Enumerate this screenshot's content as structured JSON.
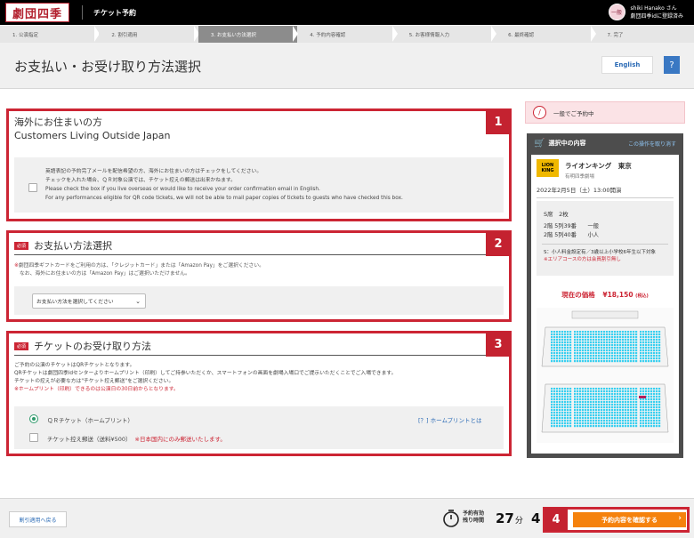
{
  "header": {
    "logo_text": "劇団四季",
    "app_title": "チケット予約",
    "avatar_text": "一般",
    "user_name": "shiki Hanako さん",
    "user_status": "劇団四季idに登録済み"
  },
  "steps": [
    {
      "label": "1. 公演指定",
      "state": "done"
    },
    {
      "label": "2. 割引適用",
      "state": "done"
    },
    {
      "label": "3. お支払い方法選択",
      "state": "active"
    },
    {
      "label": "4. 予約内容確認",
      "state": "todo"
    },
    {
      "label": "5. お客様情報入力",
      "state": "todo"
    },
    {
      "label": "6. 最終確認",
      "state": "todo"
    },
    {
      "label": "7. 完了",
      "state": "todo"
    }
  ],
  "title": {
    "text": "お支払い・お受け取り方法選択",
    "english_label": "English",
    "help_label": "?"
  },
  "section1": {
    "badge": "1",
    "heading_ja": "海外にお住まいの方",
    "heading_en": "Customers Living Outside Japan",
    "lines": [
      "英語表記の予約完了メールを配信希望の方、海外にお住まいの方はチェックをしてください。",
      "チェックを入れた場合、ＱＲ対象公演では、チケット控えの郵送は出来かねます。",
      "Please check the box if you live overseas or would like to receive your order confirmation email in English.",
      "For any performances eligible for QR code tickets, we will not be able to mail paper copies of tickets to guests who have checked this box."
    ]
  },
  "section2": {
    "badge": "2",
    "required": "必須",
    "heading": "お支払い方法選択",
    "note_mark": "※",
    "note_line1": "劇団四季ギフトカードをご利用の方は、「クレジットカード」または「Amazon Pay」をご選択ください。",
    "note_line2": "なお、海外にお住まいの方は「Amazon Pay」はご選択いただけません。",
    "select_value": "お支払い方法を選択してください"
  },
  "section3": {
    "badge": "3",
    "required": "必須",
    "heading": "チケットのお受け取り方法",
    "lines": [
      "ご予約の公演のチケットはQRチケットとなります。",
      "QRチケットは劇団四季idセンターよりホームプリント（印刷）してご持参いただくか、スマートフォンの画面を劇場入場口でご提示いただくことでご入場できます。",
      "チケットの控えが必要な方は\"チケット控え郵送\"をご選択ください。"
    ],
    "red_line": "※ホームプリント（印刷）できるのは公演日の30日前からとなります。",
    "option1": "ＱＲチケット（ホームプリント）",
    "help_link": "[？] ホームプリントとは",
    "option2": "チケット控え郵送（送料¥500）",
    "option2_note": "※日本国内にのみ郵送いたします。"
  },
  "sidebar": {
    "banner": "一般でご予約中",
    "panel_title": "選択中の内容",
    "undo_link": "この操作を取り消す",
    "show_logo": "LION KING",
    "show_name": "ライオンキング　東京",
    "theater": "有明四季劇場",
    "datetime": "2022年2月5日（土）13:00開演",
    "seat_line": "S席　2枚",
    "seat1": "2階 5列39番　　一般",
    "seat2": "2階 5列40番　　小人",
    "note_s": "S：小人料金設定有／3歳以上小学校6年生以下対象",
    "note_red": "※エリアコースの方は会員割引無し",
    "price_label": "現在の価格",
    "price_value": "¥18,150",
    "price_tax": "(税込)"
  },
  "footer": {
    "back_label": "割引適用へ戻る",
    "timer_label_1": "予約有効",
    "timer_label_2": "残り時間",
    "minutes": "27",
    "minutes_unit": "分",
    "seconds": "4",
    "confirm_label": "予約内容を確認する",
    "badge": "4"
  },
  "colors": {
    "accent_red": "#cc2534",
    "confirm_orange": "#f5820d",
    "seat_cyan": "#3ad0f0"
  }
}
